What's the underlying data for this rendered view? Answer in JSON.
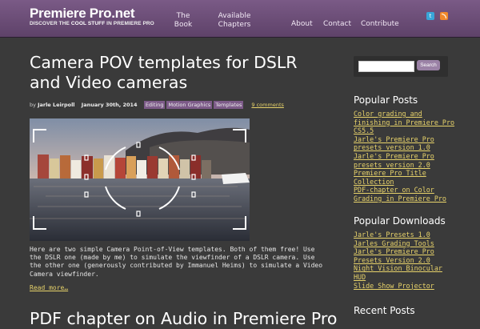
{
  "site": {
    "title": "Premiere Pro.net",
    "tagline_prefix": "DISCOVER THE ",
    "tagline_bold": "COOL STUFF",
    "tagline_suffix": " IN PREMIERE PRO"
  },
  "nav": {
    "the_book": "The\nBook",
    "available_chapters": "Available\nChapters",
    "about": "About",
    "contact": "Contact",
    "contribute": "Contribute"
  },
  "social": {
    "twitter_icon": "twitter-icon",
    "rss_icon": "rss-icon"
  },
  "post": {
    "title": "Camera POV templates for DSLR and Video cameras",
    "by": "by",
    "author": "Jarle Leirpoll",
    "date": "January 30th, 2014",
    "tags": [
      "Editing",
      "Motion Graphics",
      "Templates"
    ],
    "comments": "9 comments",
    "excerpt": "Here are two simple Camera Point-of-View templates. Both of them free! Use the DSLR one (made by me) to simulate the viewfinder of a DSLR camera. Use the other one (generously contributed by Immanuel Heims) to simulate a Video Camera viewfinder.",
    "read_more": "Read more…"
  },
  "next_post": {
    "title": "PDF chapter on Audio in Premiere Pro"
  },
  "sidebar": {
    "search_button": "Search",
    "search_value": "",
    "popular_posts_heading": "Popular Posts",
    "popular_posts": [
      "Color grading and finishing in Premiere Pro CS5.5",
      "Jarle's Premiere Pro presets version 1.0",
      "Jarle's Premiere Pro presets version 2.0",
      "Premiere Pro Title Collection",
      "PDF-chapter on Color Grading in Premiere Pro"
    ],
    "popular_downloads_heading": "Popular Downloads",
    "popular_downloads": [
      "Jarle's Presets 1.0",
      "Jarles Grading Tools",
      "Jarle's Premiere Pro Presets Version 2.0",
      "Night Vision Binocular HUD",
      "Slide Show Projector"
    ],
    "recent_posts_heading": "Recent Posts"
  },
  "colors": {
    "header": "#6b4d77",
    "link": "#e8d36a",
    "tag": "#7d5b89",
    "background": "#3a3a3a"
  }
}
